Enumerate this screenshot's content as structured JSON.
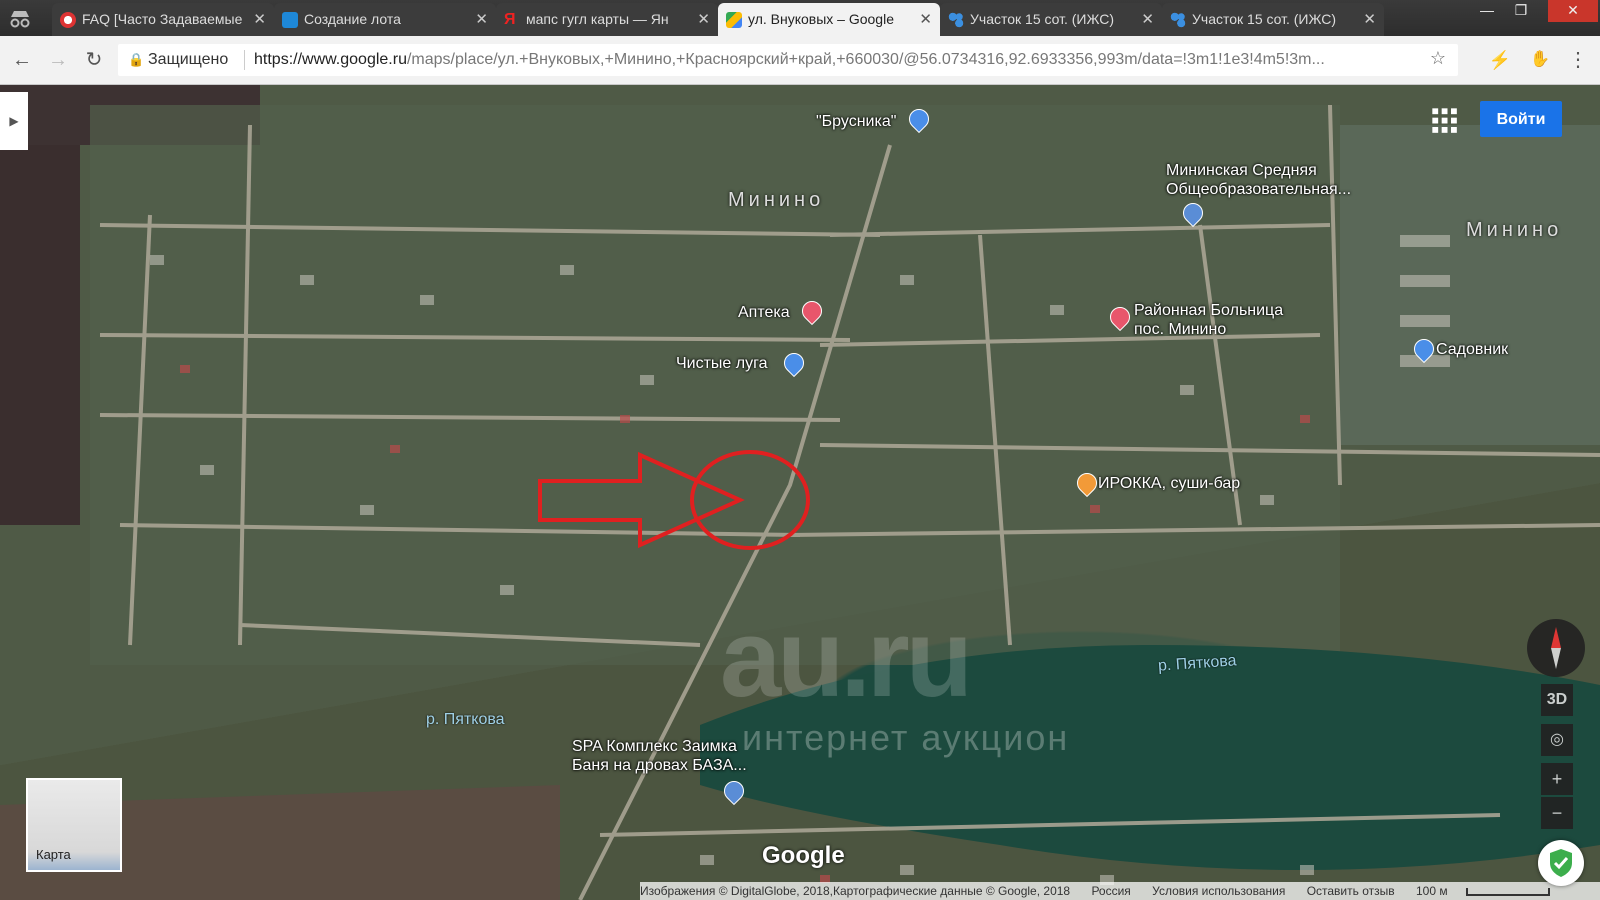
{
  "browser": {
    "tabs": [
      {
        "label": "FAQ [Часто Задаваемые",
        "icon": "opera-icon",
        "active": false
      },
      {
        "label": "Создание лота",
        "icon": "au-icon",
        "active": false
      },
      {
        "label": "мапс гугл карты — Ян",
        "icon": "yandex-icon",
        "active": false
      },
      {
        "label": "ул. Внуковых – Google",
        "icon": "google-maps-icon",
        "active": true
      },
      {
        "label": "Участок 15 сот. (ИЖС)",
        "icon": "au-drops-icon",
        "active": false
      },
      {
        "label": "Участок 15 сот. (ИЖС)",
        "icon": "au-drops-icon",
        "active": false
      }
    ],
    "security_label": "Защищено",
    "url_host": "https://www.google.ru",
    "url_path": "/maps/place/ул.+Внуковых,+Минино,+Красноярский+край,+660030/@56.0734316,92.6933356,993m/data=!3m1!1e3!4m5!3m...",
    "window_controls": [
      "—",
      "❐",
      "✕"
    ]
  },
  "map": {
    "login_label": "Войти",
    "town_labels": [
      "Минино",
      "Минино"
    ],
    "places": [
      {
        "name": "\"Брусника\"",
        "pin_color": "#4a8ee8"
      },
      {
        "name": "Мининская Средняя\nОбщеобразовательная...",
        "pin_color": "#5a8dd6"
      },
      {
        "name": "Аптека",
        "pin_color": "#e8566b"
      },
      {
        "name": "Районная Больница\nпос. Минино",
        "pin_color": "#e8566b"
      },
      {
        "name": "Чистые луга",
        "pin_color": "#4a8ee8"
      },
      {
        "name": "Садовник",
        "pin_color": "#4a8ee8"
      },
      {
        "name": "ИРОККА, суши-бар",
        "pin_color": "#f29a38"
      },
      {
        "name": "SPA Комплекс Заимка\nБаня на дровах БАЗА...",
        "pin_color": "#5a8dd6"
      }
    ],
    "water_labels": [
      "р. Пяткова",
      "р. Пяткова"
    ],
    "watermark_text": "au.ru",
    "watermark_sub": "интернет аукцион",
    "minimap_label": "Карта",
    "btn_3d": "3D",
    "zoom_in": "+",
    "zoom_out": "−",
    "google_logo": "Google",
    "attribution": {
      "imagery": "Изображения © DigitalGlobe, 2018,Картографические данные © Google, 2018",
      "region": "Россия",
      "terms": "Условия использования",
      "feedback": "Оставить отзыв",
      "scale": "100 м"
    },
    "annotation": {
      "arrow_color": "#e02020",
      "circle_color": "#e02020"
    }
  }
}
